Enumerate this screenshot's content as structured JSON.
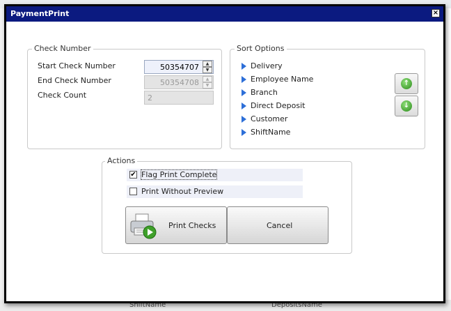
{
  "window": {
    "title": "PaymentPrint",
    "close_glyph": "×"
  },
  "background": {
    "bottom_left": "ShiftName",
    "bottom_right": "DepositsName"
  },
  "check_number": {
    "legend": "Check Number",
    "start_label": "Start Check Number",
    "start_value": "50354707",
    "end_label": "End Check Number",
    "end_value": "50354708",
    "count_label": "Check Count",
    "count_value": "2"
  },
  "sort_options": {
    "legend": "Sort Options",
    "items": [
      "Delivery",
      "Employee Name",
      "Branch",
      "Direct Deposit",
      "Customer",
      "ShiftName"
    ],
    "move_up_icon": "arrow-up-icon",
    "move_down_icon": "arrow-down-icon"
  },
  "actions": {
    "legend": "Actions",
    "flag_print_complete": {
      "label": "Flag Print Complete",
      "checked": true
    },
    "print_without_preview": {
      "label": "Print Without Preview",
      "checked": false
    },
    "print_button": "Print Checks",
    "cancel_button": "Cancel"
  },
  "colors": {
    "titlebar": "#0b1a80",
    "accent": "#2d6fd8",
    "green": "#2b8a1a"
  }
}
